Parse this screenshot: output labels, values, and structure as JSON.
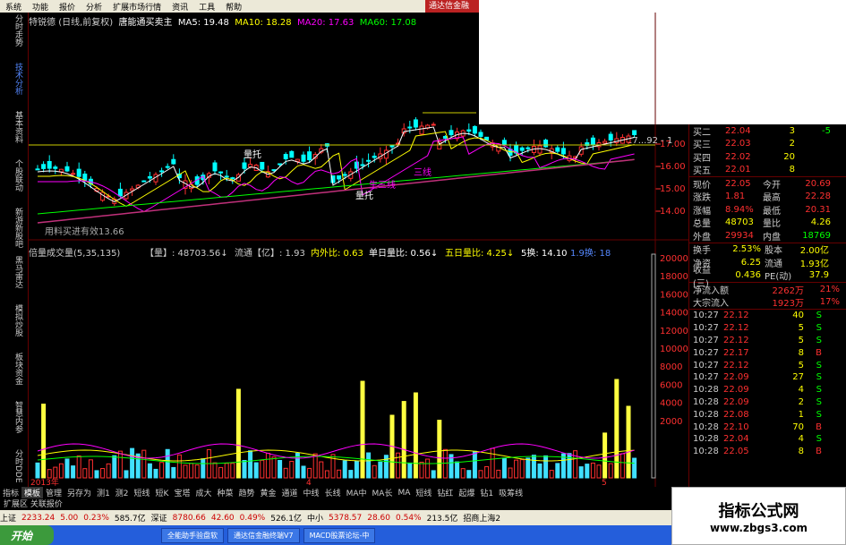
{
  "menu": [
    "系统",
    "功能",
    "报价",
    "分析",
    "扩展市场行情",
    "资讯",
    "工具",
    "帮助"
  ],
  "brand": "通达信金融",
  "left_tabs": [
    "分时走势",
    "技术分析",
    "基本资料",
    "个股联动",
    "新游新股吧"
  ],
  "left_tabs2": [
    "黑马雷达",
    "模拟炒股",
    "板块资金",
    "智慧内参",
    "分时DDE",
    "新游DDE"
  ],
  "chart_head": {
    "name": "特锐德",
    "period": "(日线,前复权)",
    "ind": "唐能通买卖主",
    "ma5": "MA5: 19.48",
    "ma10": "MA10: 18.28",
    "ma20": "MA20: 17.63",
    "ma60": "MA60: 17.08"
  },
  "vol_head": {
    "a": "倍量成交量(5,35,135)",
    "b": "【量】: 48703.56↓",
    "c": "流通【亿】: 1.93",
    "d": "内外比: 0.63",
    "e": "单日量比: 0.56↓",
    "f": "五日量比: 4.25↓",
    "g": "5换: 14.10",
    "h": "1.9换: 18"
  },
  "price_annot": [
    "用料买进有效13.66",
    "量托",
    "生三线",
    "量托",
    "量托",
    "三线",
    "三线"
  ],
  "price_labels": [
    "17.00",
    "16.00",
    "15.00",
    "14.00"
  ],
  "vol_labels": [
    "20000",
    "18000",
    "16000",
    "14000",
    "12000",
    "10000",
    "8000",
    "6000",
    "4000",
    "2000"
  ],
  "x_labels": [
    "2013年",
    "4",
    "5"
  ],
  "axis_top": "17...92 - 1",
  "book": [
    {
      "l": "买二",
      "p": "22.04",
      "q": "3",
      "d": "-5"
    },
    {
      "l": "买三",
      "p": "22.03",
      "q": "2",
      "d": ""
    },
    {
      "l": "买四",
      "p": "22.02",
      "q": "20",
      "d": ""
    },
    {
      "l": "买五",
      "p": "22.01",
      "q": "8",
      "d": ""
    }
  ],
  "stats": [
    [
      "现价",
      "22.05",
      "今开",
      "20.69"
    ],
    [
      "涨跌",
      "1.81",
      "最高",
      "22.28"
    ],
    [
      "涨幅",
      "8.94%",
      "最低",
      "20.31"
    ],
    [
      "总量",
      "48703",
      "量比",
      "4.26"
    ],
    [
      "外盘",
      "29934",
      "内盘",
      "18769"
    ]
  ],
  "stats2": [
    [
      "换手",
      "2.53%",
      "股本",
      "2.00亿"
    ],
    [
      "净资",
      "6.25",
      "流通",
      "1.93亿"
    ],
    [
      "收益(三)",
      "0.436",
      "PE(动)",
      "37.9"
    ]
  ],
  "flow": [
    [
      "净流入额",
      "2262万",
      "21%"
    ],
    [
      "大宗流入",
      "1923万",
      "17%"
    ]
  ],
  "ticks": [
    [
      "10:27",
      "22.12",
      "40",
      "S"
    ],
    [
      "10:27",
      "22.12",
      "5",
      "S"
    ],
    [
      "10:27",
      "22.12",
      "5",
      "S"
    ],
    [
      "10:27",
      "22.17",
      "8",
      "B"
    ],
    [
      "10:27",
      "22.12",
      "5",
      "S"
    ],
    [
      "10:27",
      "22.09",
      "27",
      "S"
    ],
    [
      "10:28",
      "22.09",
      "4",
      "S"
    ],
    [
      "10:28",
      "22.09",
      "2",
      "S"
    ],
    [
      "10:28",
      "22.08",
      "1",
      "S"
    ],
    [
      "10:28",
      "22.10",
      "70",
      "B"
    ],
    [
      "10:28",
      "22.04",
      "4",
      "S"
    ],
    [
      "10:28",
      "22.05",
      "8",
      "B"
    ]
  ],
  "tabs": [
    "指标",
    "模板",
    "管理",
    "另存为",
    "测1",
    "测2",
    "短线",
    "短K",
    "宝塔",
    "成大",
    "种菜",
    "趋势",
    "黄金",
    "通道",
    "中线",
    "长线",
    "MA中",
    "MA长",
    "MA",
    "短线",
    "钻红",
    "起爆",
    "钻1",
    "吸筹线"
  ],
  "tabs2": "扩展区  关联报价",
  "daily": "日线",
  "status": [
    {
      "t": "上证",
      "c": "#000"
    },
    {
      "t": "2233.24",
      "c": "#c00"
    },
    {
      "t": "5.00",
      "c": "#c00"
    },
    {
      "t": "0.23%",
      "c": "#c00"
    },
    {
      "t": "585.7亿",
      "c": "#000"
    },
    {
      "t": "深证",
      "c": "#000"
    },
    {
      "t": "8780.66",
      "c": "#c00"
    },
    {
      "t": "42.60",
      "c": "#c00"
    },
    {
      "t": "0.49%",
      "c": "#c00"
    },
    {
      "t": "526.1亿",
      "c": "#000"
    },
    {
      "t": "中小",
      "c": "#000"
    },
    {
      "t": "5378.57",
      "c": "#c00"
    },
    {
      "t": "28.60",
      "c": "#c00"
    },
    {
      "t": "0.54%",
      "c": "#c00"
    },
    {
      "t": "213.5亿",
      "c": "#000"
    },
    {
      "t": "招商上海2",
      "c": "#000"
    }
  ],
  "taskbar": {
    "start": "开始",
    "items": [
      "全能助手验盘软",
      "通达信金融终端V7",
      "MACD股票论坛-中"
    ]
  },
  "watermark": {
    "title": "指标公式网",
    "url": "www.zbgs3.com"
  },
  "colors": {
    "up": "#ff3030",
    "down": "#00ffff",
    "ma5": "#ffffff",
    "ma10": "#ffff00",
    "ma20": "#ff00ff",
    "ma60": "#00ff00",
    "vol_yellow": "#ffff40",
    "vol_cyan": "#40e0ff",
    "vol_red": "#ff3030"
  }
}
